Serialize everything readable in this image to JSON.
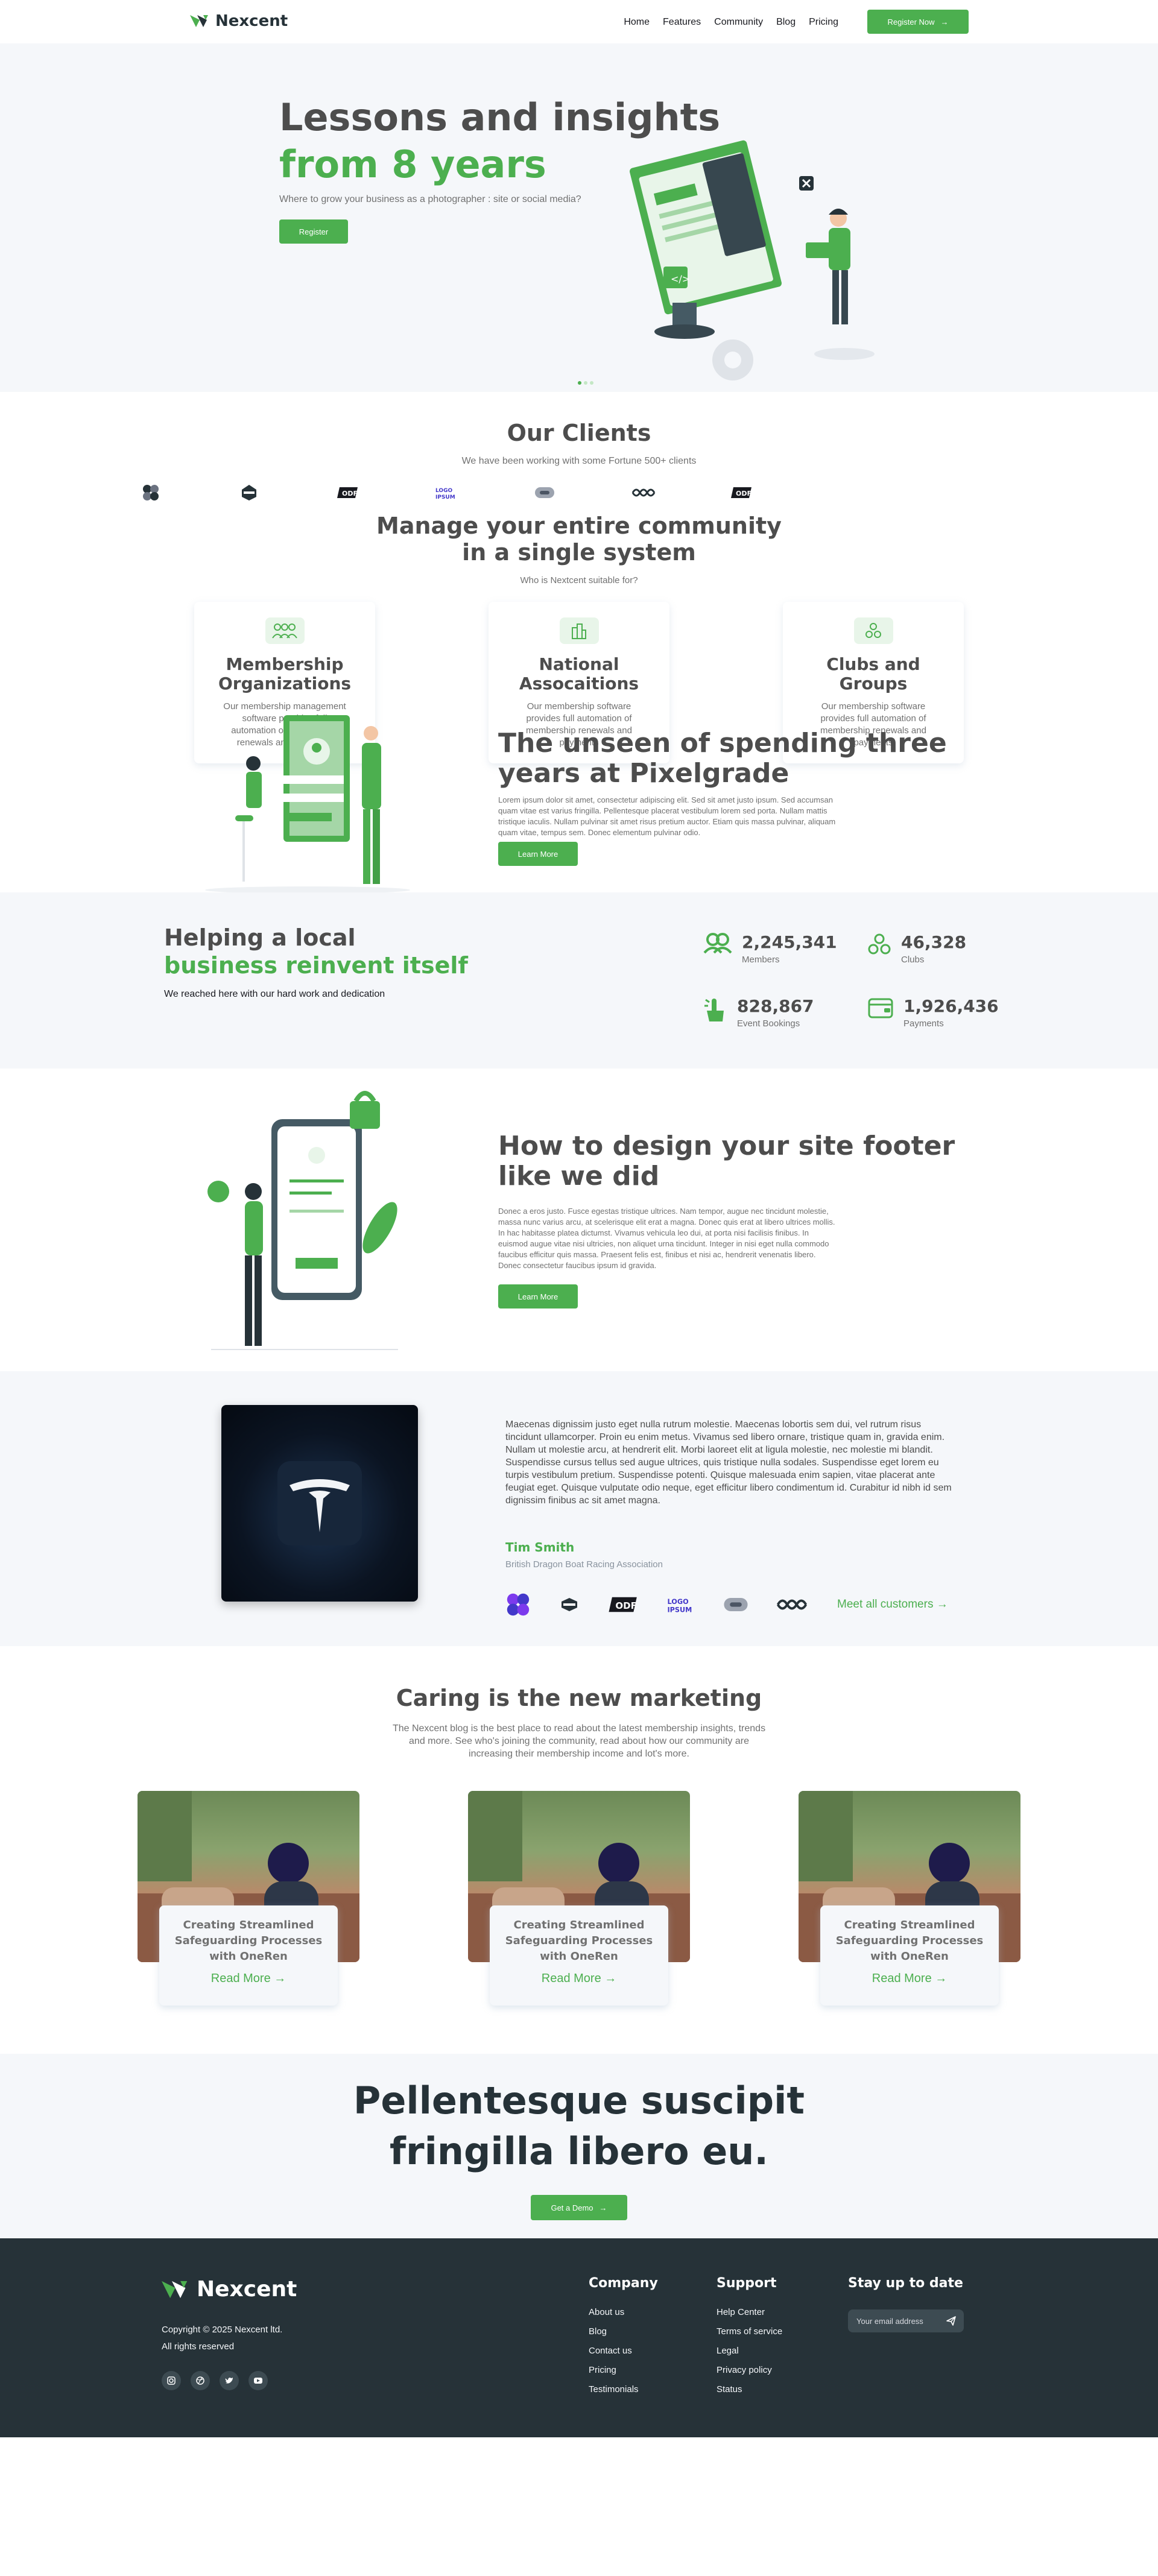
{
  "header": {
    "brand": "Nexcent",
    "nav": [
      "Home",
      "Features",
      "Community",
      "Blog",
      "Pricing"
    ],
    "register_label": "Register Now"
  },
  "hero": {
    "title_line1": "Lessons and insights",
    "title_line2": "from 8 years",
    "subtitle": "Where to grow your business as a photographer : site or social media?",
    "button": "Register",
    "carousel": {
      "slides": 3,
      "active": 1
    }
  },
  "clients": {
    "title": "Our Clients",
    "subtitle": "We have been working with some Fortune 500+ clients"
  },
  "community": {
    "title_line1": "Manage your entire community",
    "title_line2": "in a single system",
    "subtitle": "Who is Nextcent suitable for?",
    "cards": [
      {
        "title": "Membership Organizations",
        "text": "Our membership management software provides full automation of membership renewals and payments"
      },
      {
        "title": "National Assocaitions",
        "text": "Our membership software provides full automation of membership renewals and payments"
      },
      {
        "title": "Clubs and Groups",
        "text": "Our membership software provides full automation of membership renewals and payments"
      }
    ]
  },
  "feature1": {
    "title": "The unseen of spending three years at Pixelgrade",
    "body": "Lorem ipsum dolor sit amet, consectetur adipiscing elit. Sed sit amet justo ipsum. Sed accumsan quam vitae est varius fringilla. Pellentesque placerat vestibulum lorem sed porta. Nullam mattis tristique iaculis. Nullam pulvinar sit amet risus pretium auctor. Etiam quis massa pulvinar, aliquam quam vitae, tempus sem. Donec elementum pulvinar odio.",
    "button": "Learn More"
  },
  "stats": {
    "title_line1": "Helping a local",
    "title_line2": "business reinvent itself",
    "subtitle": "We reached here with our hard work and dedication",
    "items": [
      {
        "value": "2,245,341",
        "label": "Members"
      },
      {
        "value": "46,328",
        "label": "Clubs"
      },
      {
        "value": "828,867",
        "label": "Event Bookings"
      },
      {
        "value": "1,926,436",
        "label": "Payments"
      }
    ]
  },
  "feature2": {
    "title": "How to design your site footer like we did",
    "body": "Donec a eros justo. Fusce egestas tristique ultrices. Nam tempor, augue nec tincidunt molestie, massa nunc varius arcu, at scelerisque elit erat a magna. Donec quis erat at libero ultrices mollis. In hac habitasse platea dictumst. Vivamus vehicula leo dui, at porta nisi facilisis finibus. In euismod augue vitae nisi ultricies, non aliquet urna tincidunt. Integer in nisi eget nulla commodo faucibus efficitur quis massa. Praesent felis est, finibus et nisi ac, hendrerit venenatis libero. Donec consectetur faucibus ipsum id gravida.",
    "button": "Learn More"
  },
  "testimonial": {
    "quote": "Maecenas dignissim justo eget nulla rutrum molestie. Maecenas lobortis sem dui, vel rutrum risus tincidunt ullamcorper. Proin eu enim metus. Vivamus sed libero ornare, tristique quam in, gravida enim. Nullam ut molestie arcu, at hendrerit elit. Morbi laoreet elit at ligula molestie, nec molestie mi blandit. Suspendisse cursus tellus sed augue ultrices, quis tristique nulla sodales. Suspendisse eget lorem eu turpis vestibulum pretium. Suspendisse potenti. Quisque malesuada enim sapien, vitae placerat ante feugiat eget. Quisque vulputate odio neque, eget efficitur libero condimentum id. Curabitur id nibh id sem dignissim finibus ac sit amet magna.",
    "name": "Tim Smith",
    "org": "British Dragon Boat Racing Association",
    "meet_all": "Meet all customers →"
  },
  "blog": {
    "title": "Caring is the new marketing",
    "subtitle": "The Nexcent blog is the best place to read about the latest membership insights, trends and more. See who's joining the community, read about how our community are increasing their membership income and lot's more.",
    "posts": [
      {
        "title": "Creating Streamlined Safeguarding Processes with OneRen",
        "link": "Read More →"
      },
      {
        "title": "Creating Streamlined Safeguarding Processes with OneRen",
        "link": "Read More →"
      },
      {
        "title": "Creating Streamlined Safeguarding Processes with OneRen",
        "link": "Read More →"
      }
    ]
  },
  "cta": {
    "title_line1": "Pellentesque suscipit",
    "title_line2": "fringilla libero eu.",
    "button": "Get a Demo"
  },
  "footer": {
    "brand": "Nexcent",
    "copyright": "Copyright © 2025 Nexcent ltd.",
    "rights": "All rights reserved",
    "company_heading": "Company",
    "company_links": [
      "About us",
      "Blog",
      "Contact us",
      "Pricing",
      "Testimonials"
    ],
    "support_heading": "Support",
    "support_links": [
      "Help Center",
      "Terms of service",
      "Legal",
      "Privacy policy",
      "Status"
    ],
    "subscribe_heading": "Stay up to date",
    "email_placeholder": "Your email address"
  },
  "colors": {
    "primary": "#4caf4f",
    "dark": "#263238",
    "text": "#4d4d4d",
    "muted": "#717171",
    "silver": "#f5f7fa"
  }
}
